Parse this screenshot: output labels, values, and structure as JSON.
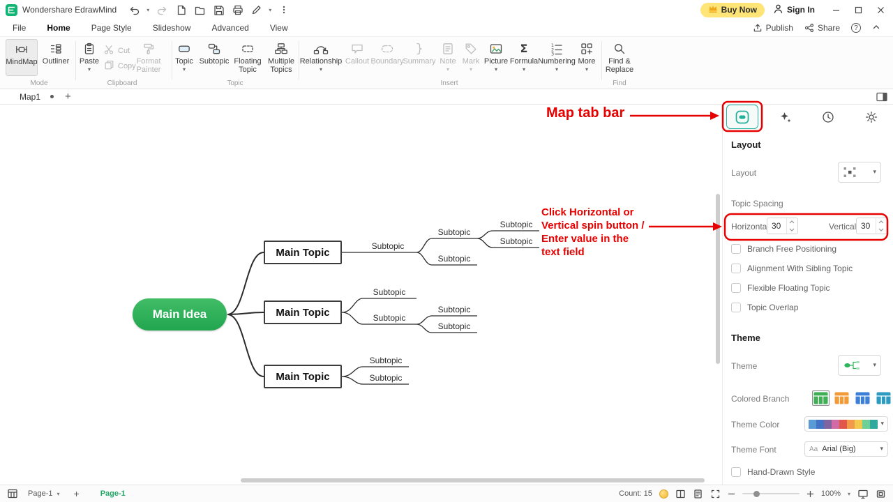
{
  "colors": {
    "brand_green": "#10b573",
    "node_green": "#2db45a",
    "annotation_red": "#e60000",
    "buy_now_yellow": "#ffe478",
    "panel_accent_teal": "#26b3a0",
    "active_page_green": "#21a766"
  },
  "titlebar": {
    "app_name": "Wondershare EdrawMind",
    "buy_now": "Buy Now",
    "sign_in": "Sign In"
  },
  "menubar": {
    "file": "File",
    "home": "Home",
    "page_style": "Page Style",
    "slideshow": "Slideshow",
    "advanced": "Advanced",
    "view": "View",
    "publish": "Publish",
    "share": "Share"
  },
  "ribbon": {
    "group_labels": {
      "mode": "Mode",
      "clipboard": "Clipboard",
      "topic": "Topic",
      "insert": "Insert",
      "find": "Find"
    },
    "buttons": {
      "mindmap": "MindMap",
      "outliner": "Outliner",
      "paste": "Paste",
      "cut": "Cut",
      "copy": "Copy",
      "format_painter": "Format Painter",
      "topic": "Topic",
      "subtopic": "Subtopic",
      "floating_topic": "Floating Topic",
      "multiple_topics": "Multiple Topics",
      "relationship": "Relationship",
      "callout": "Callout",
      "boundary": "Boundary",
      "summary": "Summary",
      "note": "Note",
      "mark": "Mark",
      "picture": "Picture",
      "formula": "Formula",
      "numbering": "Numbering",
      "more": "More",
      "find_replace": "Find & Replace"
    }
  },
  "tabbar": {
    "document_tab": "Map1"
  },
  "canvas": {
    "main_idea": "Main Idea",
    "main_topics": [
      "Main Topic",
      "Main Topic",
      "Main Topic"
    ],
    "subtopics": [
      "Subtopic",
      "Subtopic",
      "Subtopic",
      "Subtopic",
      "Subtopic",
      "Subtopic",
      "Subtopic",
      "Subtopic",
      "Subtopic",
      "Subtopic",
      "Subtopic"
    ]
  },
  "annotations": {
    "map_tab_bar": "Map tab bar",
    "spin_hint_lines": [
      "Click Horizontal or",
      "Vertical spin button /",
      "Enter value in the",
      "text field"
    ]
  },
  "panel": {
    "layout_section": "Layout",
    "layout_label": "Layout",
    "topic_spacing": "Topic Spacing",
    "horizontal_label": "Horizontal",
    "horizontal_value": "30",
    "vertical_label": "Vertical",
    "vertical_value": "30",
    "checkboxes": [
      "Branch Free Positioning",
      "Alignment With Sibling Topic",
      "Flexible Floating Topic",
      "Topic Overlap"
    ],
    "theme_section": "Theme",
    "theme_label": "Theme",
    "colored_branch": "Colored Branch",
    "theme_color": "Theme Color",
    "theme_font": "Theme Font",
    "font_sample": "Aa",
    "font_value": "Arial (Big)",
    "hand_drawn": "Hand-Drawn Style"
  },
  "statusbar": {
    "page_selector": "Page-1",
    "active_page_tab": "Page-1",
    "count": "Count: 15",
    "zoom": "100%"
  }
}
